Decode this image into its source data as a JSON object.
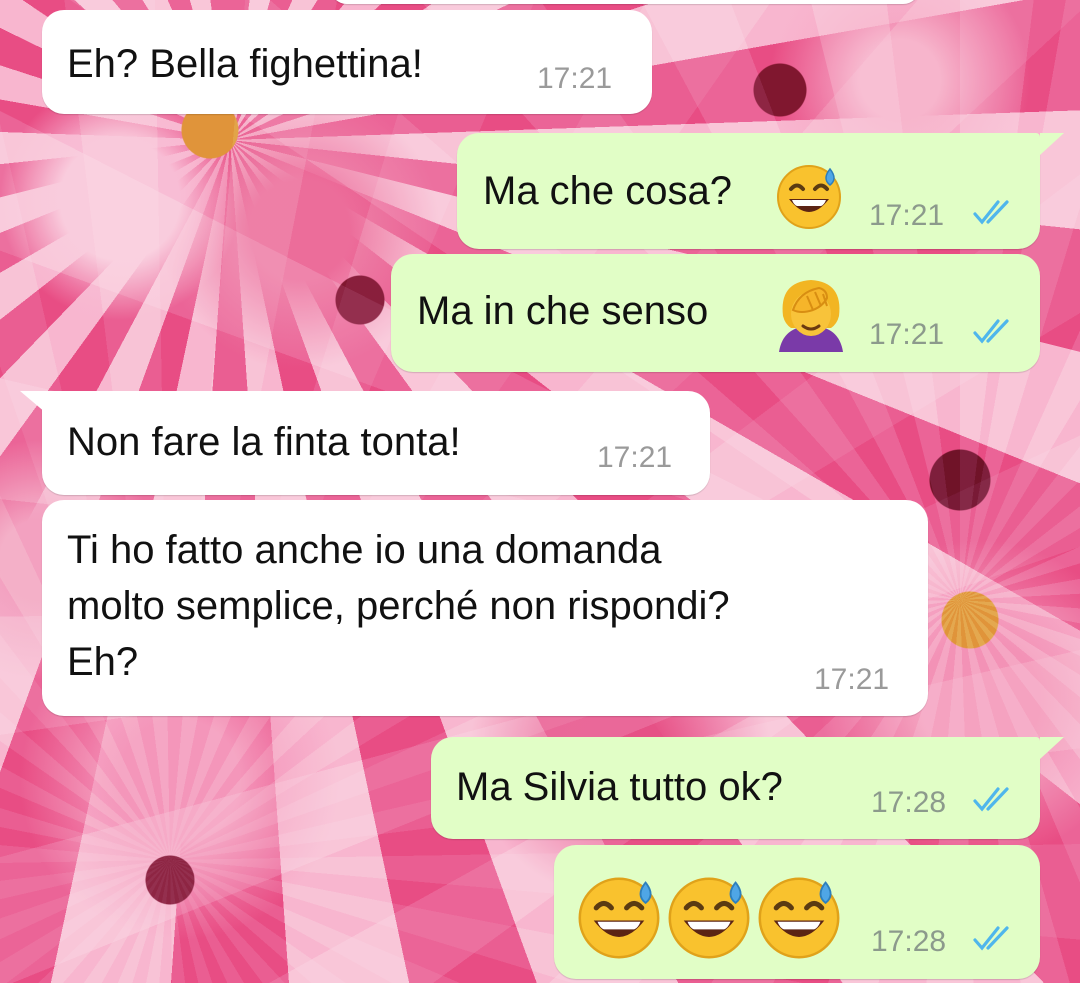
{
  "messages": [
    {
      "direction": "in",
      "text": "Eh? Bella fighettina!",
      "time": "17:21"
    },
    {
      "direction": "out",
      "text": "Ma che cosa?",
      "emoji": "grinning-face-with-sweat",
      "time": "17:21",
      "status": "read"
    },
    {
      "direction": "out",
      "text": "Ma in che senso",
      "emoji": "woman-facepalming",
      "time": "17:21",
      "status": "read"
    },
    {
      "direction": "in",
      "text": "Non fare la finta tonta!",
      "time": "17:21"
    },
    {
      "direction": "in",
      "text": "Ti ho fatto anche io una domanda\nmolto semplice, perché non rispondi?\nEh?",
      "time": "17:21"
    },
    {
      "direction": "out",
      "text": "Ma Silvia tutto ok?",
      "time": "17:28",
      "status": "read"
    },
    {
      "direction": "out",
      "emoji": "grinning-face-with-sweat x3",
      "time": "17:28",
      "status": "read"
    }
  ],
  "colors": {
    "incoming_bubble": "#ffffff",
    "outgoing_bubble": "#e1fec6",
    "read_ticks": "#4fb6ec",
    "timestamp": "#8c9a8c"
  }
}
